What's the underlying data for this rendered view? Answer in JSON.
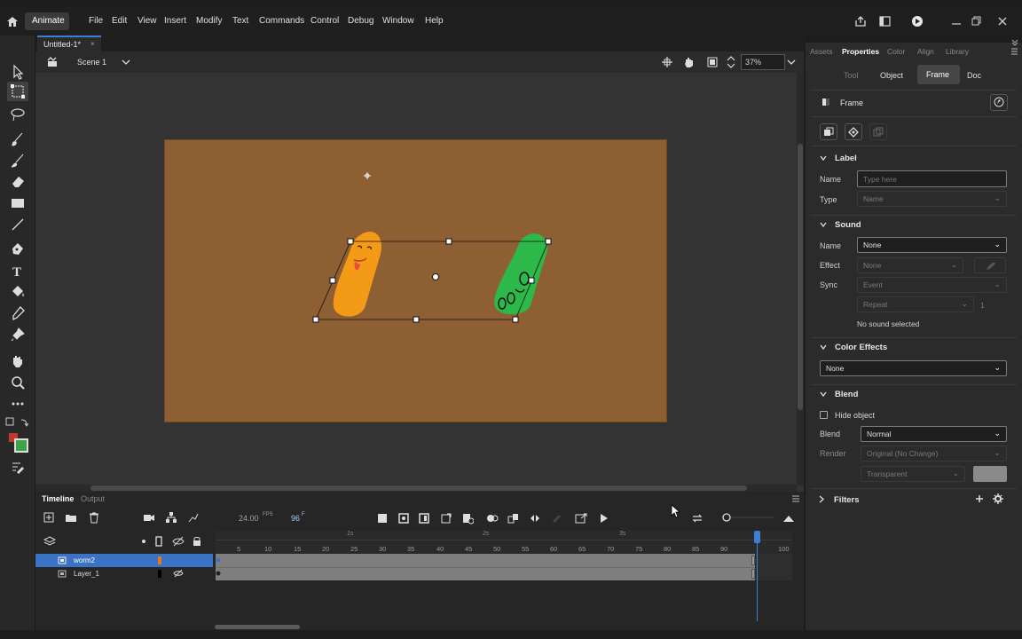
{
  "app": {
    "name": "Animate"
  },
  "menu": [
    "File",
    "Edit",
    "View",
    "Insert",
    "Modify",
    "Text",
    "Commands",
    "Control",
    "Debug",
    "Window",
    "Help"
  ],
  "document": {
    "tab": "Untitled-1*"
  },
  "stage": {
    "scene": "Scene 1",
    "zoom": "37%",
    "background": "#8d5f33"
  },
  "timeline": {
    "tabs": [
      "Timeline",
      "Output"
    ],
    "fps": "24.00",
    "fps_unit": "FPS",
    "frame": "96",
    "frame_unit": "F",
    "seconds": [
      "1s",
      "2s",
      "3s"
    ],
    "ruler": [
      "5",
      "10",
      "15",
      "20",
      "25",
      "30",
      "35",
      "40",
      "45",
      "50",
      "55",
      "60",
      "65",
      "70",
      "75",
      "80",
      "85",
      "90",
      "100"
    ],
    "layers": [
      {
        "name": "worm2",
        "color": "#e07a20",
        "selected": true
      },
      {
        "name": "Layer_1",
        "color": "#000000",
        "selected": false
      }
    ]
  },
  "panel": {
    "tabs": [
      "Assets",
      "Properties",
      "Color",
      "Align",
      "Library"
    ],
    "subtabs": [
      "Tool",
      "Object",
      "Frame",
      "Doc"
    ],
    "frame_title": "Frame",
    "label": {
      "header": "Label",
      "name_label": "Name",
      "name_placeholder": "Type here",
      "type_label": "Type",
      "type_value": "Name"
    },
    "sound": {
      "header": "Sound",
      "name_label": "Name",
      "name_value": "None",
      "effect_label": "Effect",
      "effect_value": "None",
      "sync_label": "Sync",
      "sync_value": "Event",
      "repeat_value": "Repeat",
      "repeat_count": "1",
      "status": "No sound selected"
    },
    "color_effects": {
      "header": "Color Effects",
      "value": "None"
    },
    "blend": {
      "header": "Blend",
      "hide_object": "Hide object",
      "blend_label": "Blend",
      "blend_value": "Normal",
      "render_label": "Render",
      "render_value": "Original (No Change)",
      "transparent_value": "Transparent"
    },
    "filters": {
      "header": "Filters"
    }
  }
}
